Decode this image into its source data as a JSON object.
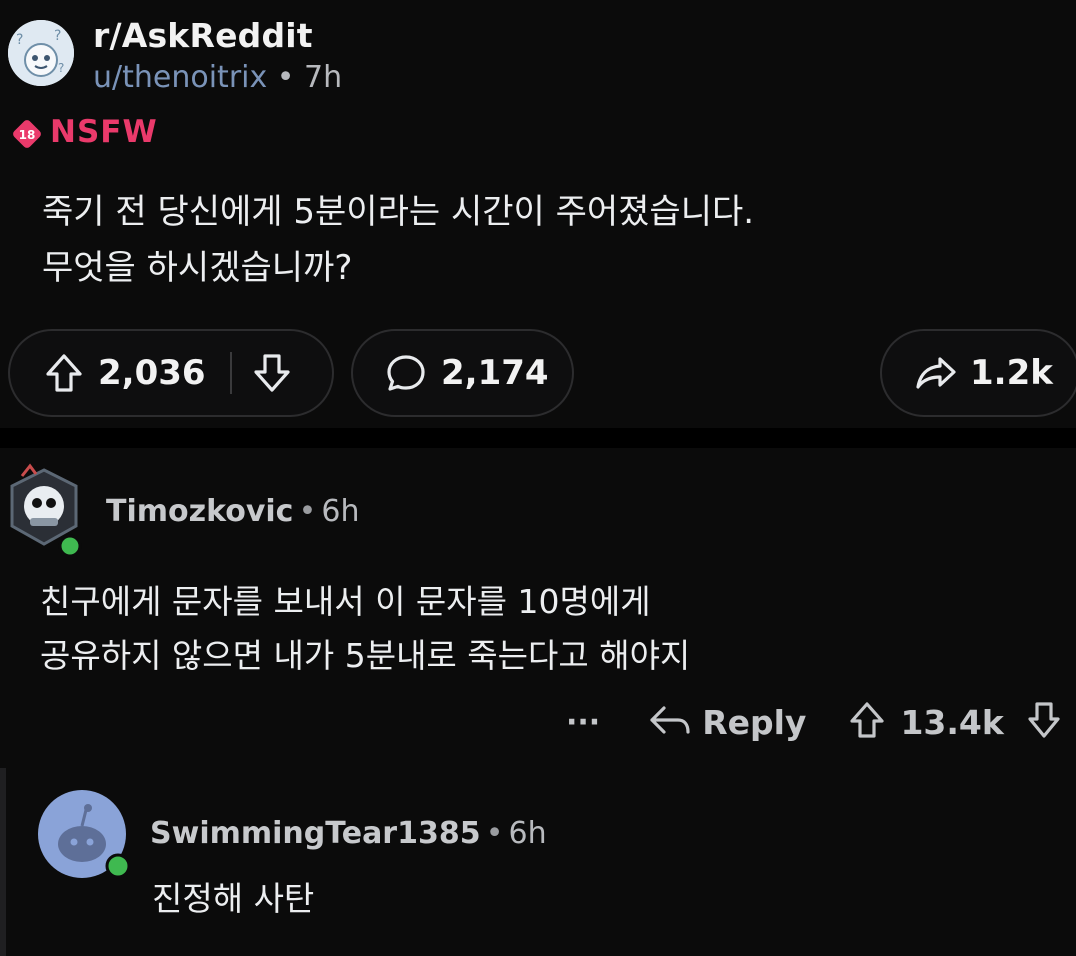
{
  "post": {
    "subreddit": "r/AskReddit",
    "username": "u/thenoitrix",
    "separator": "•",
    "time": "7h",
    "nsfw_badge_number": "18",
    "nsfw_label": "NSFW",
    "title_line1": "죽기 전 당신에게 5분이라는 시간이 주어졌습니다.",
    "title_line2": "무엇을 하시겠습니까?",
    "upvotes": "2,036",
    "comments": "2,174",
    "shares": "1.2k"
  },
  "comments": [
    {
      "author": "Timozkovic",
      "separator": "•",
      "time": "6h",
      "body_line1": "친구에게 문자를 보내서 이 문자를 10명에게",
      "body_line2": "공유하지 않으면 내가 5분내로 죽는다고 해야지",
      "more": "···",
      "reply_label": "Reply",
      "votes": "13.4k"
    },
    {
      "author": "SwimmingTear1385",
      "separator": "•",
      "time": "6h",
      "body_line1": "진정해 사탄"
    }
  ],
  "colors": {
    "background": "#0b0b0b",
    "nsfw": "#ea3a6b",
    "username_link": "#7a93b8",
    "online_dot": "#3fb950",
    "pill_border": "#2c2c2e"
  },
  "icons": [
    "subreddit-avatar-icon",
    "nsfw-icon",
    "upvote-icon",
    "downvote-icon",
    "comment-icon",
    "share-icon",
    "reply-icon",
    "more-icon",
    "snoo-avatar-icon"
  ]
}
